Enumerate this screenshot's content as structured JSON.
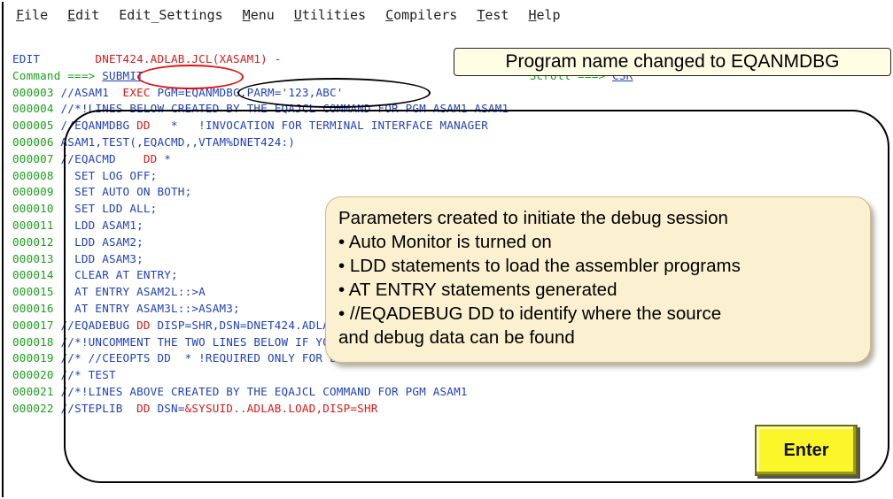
{
  "menu": [
    {
      "label": "File",
      "u": "F",
      "rest": "ile"
    },
    {
      "label": "Edit",
      "u": "E",
      "rest": "dit"
    },
    {
      "label": "Edit_Settings",
      "u": "",
      "rest": "Edit_Settings"
    },
    {
      "label": "Menu",
      "u": "M",
      "rest": "enu"
    },
    {
      "label": "Utilities",
      "u": "U",
      "rest": "tilities"
    },
    {
      "label": "Compilers",
      "u": "C",
      "rest": "ompilers"
    },
    {
      "label": "Test",
      "u": "T",
      "rest": "est"
    },
    {
      "label": "Help",
      "u": "H",
      "rest": "elp"
    }
  ],
  "edit_line": {
    "prefix": "EDIT",
    "dataset": "DNET424.ADLAB.JCL(XASAM1) - "
  },
  "command_line": {
    "label": "Command ===>",
    "value": "SUBMIT",
    "scroll_label": "Scroll ===>",
    "scroll_value": "CSR"
  },
  "line03": {
    "num": "000003",
    "a": "//ASAM1  ",
    "b": "EXEC",
    "c": " PGM=EQANMDBG,PARM='123,ABC'"
  },
  "line04": {
    "num": "000004",
    "text": "//*!LINES BELOW CREATED BY THE EQAJCL COMMAND FOR PGM ASAM1 ASAM1"
  },
  "line05": {
    "num": "000005",
    "a": "//EQANMDBG ",
    "b": "DD",
    "c": "   *   !INVOCATION FOR TERMINAL INTERFACE MANAGER"
  },
  "line06": {
    "num": "000006",
    "text": "ASAM1,TEST(,EQACMD,,VTAM%DNET424:)"
  },
  "line07": {
    "num": "000007",
    "a": "//EQACMD    ",
    "b": "DD",
    "c": " *"
  },
  "line08": {
    "num": "000008",
    "text": "  SET LOG OFF;"
  },
  "line09": {
    "num": "000009",
    "text": "  SET AUTO ON BOTH;"
  },
  "line10": {
    "num": "000010",
    "text": "  SET LDD ALL;"
  },
  "line11": {
    "num": "000011",
    "text": "  LDD ASAM1;"
  },
  "line12": {
    "num": "000012",
    "text": "  LDD ASAM2;"
  },
  "line13": {
    "num": "000013",
    "text": "  LDD ASAM3;"
  },
  "line14": {
    "num": "000014",
    "text": "  CLEAR AT ENTRY;"
  },
  "line15": {
    "num": "000015",
    "text": "  AT ENTRY ASAM2L::>A"
  },
  "line16": {
    "num": "000016",
    "text": "  AT ENTRY ASAM3L::>ASAM3;"
  },
  "line17": {
    "num": "000017",
    "a": "//EQADEBUG ",
    "b": "DD",
    "c": " DISP=SHR,DSN=DNET424.ADLAB.EQALANGX"
  },
  "line18": {
    "num": "000018",
    "text": "//*!UNCOMMENT THE TWO LINES BELOW IF YOU WANT TO DEBUG AN LE SUBPROGRAM"
  },
  "line19": {
    "num": "000019",
    "text": "//* //CEEOPTS DD  * !REQUIRED ONLY FOR LE SUBPROGRAM DEBUGG"
  },
  "line20": {
    "num": "000020",
    "text": "//* TEST"
  },
  "line21": {
    "num": "000021",
    "text": "//*!LINES ABOVE CREATED BY THE EQAJCL COMMAND FOR PGM ASAM1"
  },
  "line22": {
    "num": "000022",
    "a": "//STEPLIB  ",
    "b": "DD",
    "c": " DSN=",
    "d": "&SYSUID..ADLAB.LOAD,DISP=SHR"
  },
  "callout_top": "Program name changed to EQANMDBG",
  "callout_main": {
    "title": "Parameters created to initiate the debug session",
    "bullets": [
      "• Auto Monitor is turned on",
      "• LDD statements to load the assembler programs",
      "• AT ENTRY statements generated",
      "• //EQADEBUG DD to identify where the source",
      "and debug data can be found"
    ]
  },
  "enter_label": "Enter",
  "colors": {
    "green": "#1a9e1a",
    "blue": "#1f3fbf",
    "red": "#d91818",
    "callout_bg": "#fbf1d0",
    "enter_bg": "#fbf62a"
  }
}
